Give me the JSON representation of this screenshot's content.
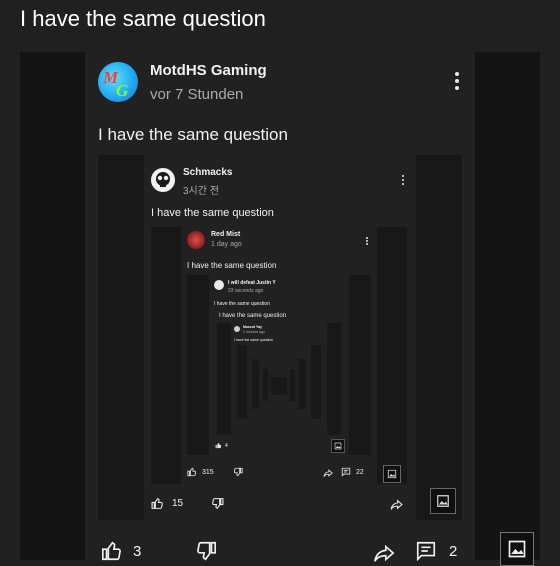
{
  "page_title": "I have the same question",
  "comment": {
    "author": "MotdHS Gaming",
    "avatar_initials": "MG",
    "time": "vor 7 Stunden",
    "text": "I have the same question",
    "likes": "3",
    "replies": "2"
  },
  "level1": {
    "author": "Schmacks",
    "time": "3시간 전",
    "text": "I have the same question",
    "likes": "15"
  },
  "level2": {
    "author": "Red Mist",
    "time": "1 day ago",
    "text": "I have the same question",
    "likes": "315",
    "replies": "22"
  },
  "level3": {
    "author": "I will defeat Justin Y",
    "time": "23 seconds ago",
    "text": "I have the same question",
    "reply_text": "I have the same question",
    "likes": "4"
  },
  "level4": {
    "author": "Mascot Yay",
    "time": "2 minutes ago",
    "text": "I have the same question"
  },
  "colors": {
    "background": "#202020",
    "sidebar": "#141414",
    "card": "#212121",
    "text": "#f1f1f1",
    "secondary_text": "#aaaaaa"
  }
}
